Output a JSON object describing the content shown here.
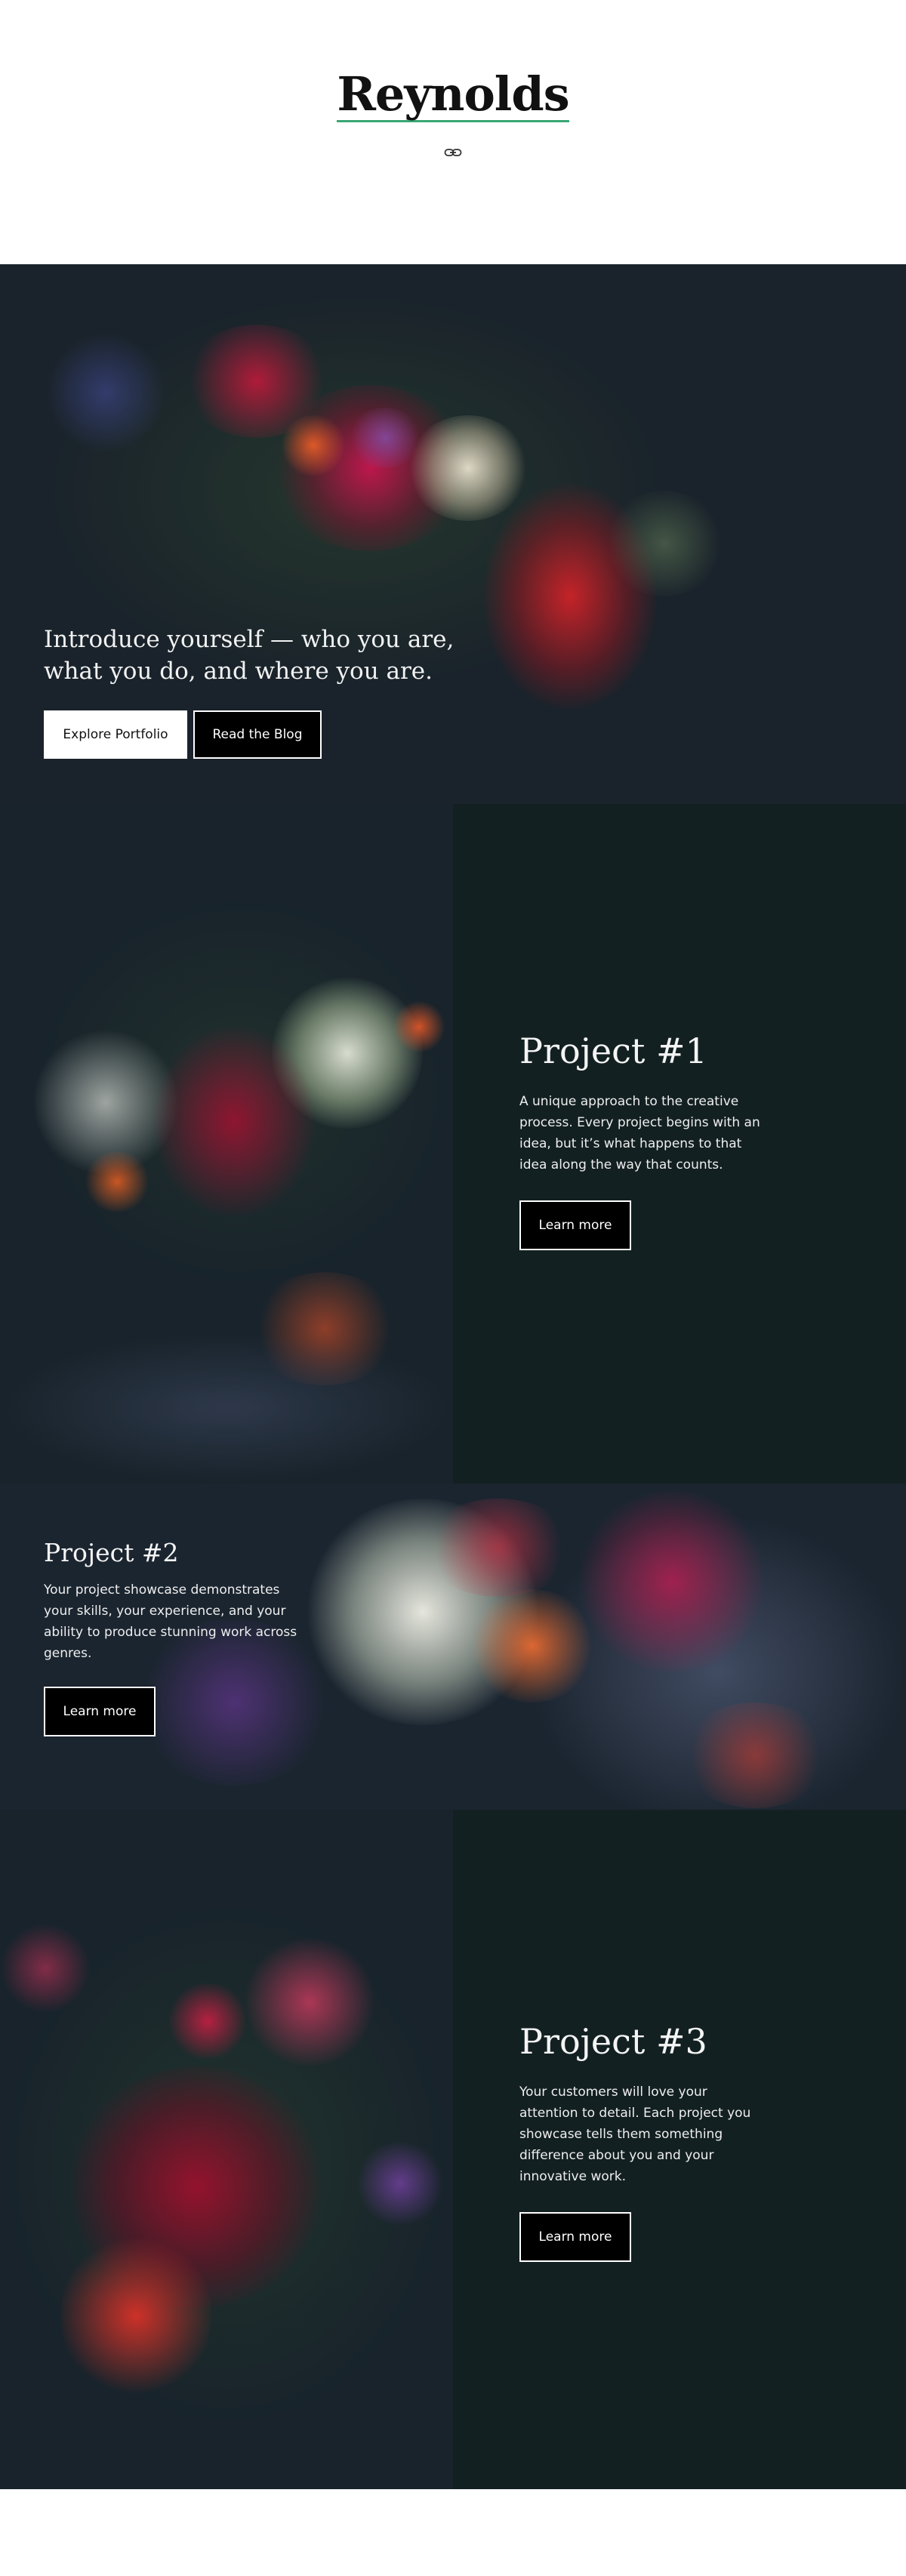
{
  "header": {
    "site_title": "Reynolds",
    "link_icon": "link-icon"
  },
  "hero": {
    "intro_text": "Introduce yourself — who you are, what you do, and where you are.",
    "primary_button": "Explore Portfolio",
    "secondary_button": "Read the Blog"
  },
  "projects": [
    {
      "title": "Project #1",
      "description": "A unique approach to the creative process. Every project begins with an idea, but it’s what happens to that idea along the way that counts.",
      "button": "Learn more"
    },
    {
      "title": "Project #2",
      "description": "Your project showcase demonstrates your skills, your experience, and your ability to produce stunning work across genres.",
      "button": "Learn more"
    },
    {
      "title": "Project #3",
      "description": "Your customers will love your attention to detail. Each project you showcase tells them something difference about you and your innovative work.",
      "button": "Learn more"
    }
  ],
  "colors": {
    "accent_underline": "#3aa775",
    "dark_panel": "#132021",
    "hero_bg": "#1a232b"
  }
}
